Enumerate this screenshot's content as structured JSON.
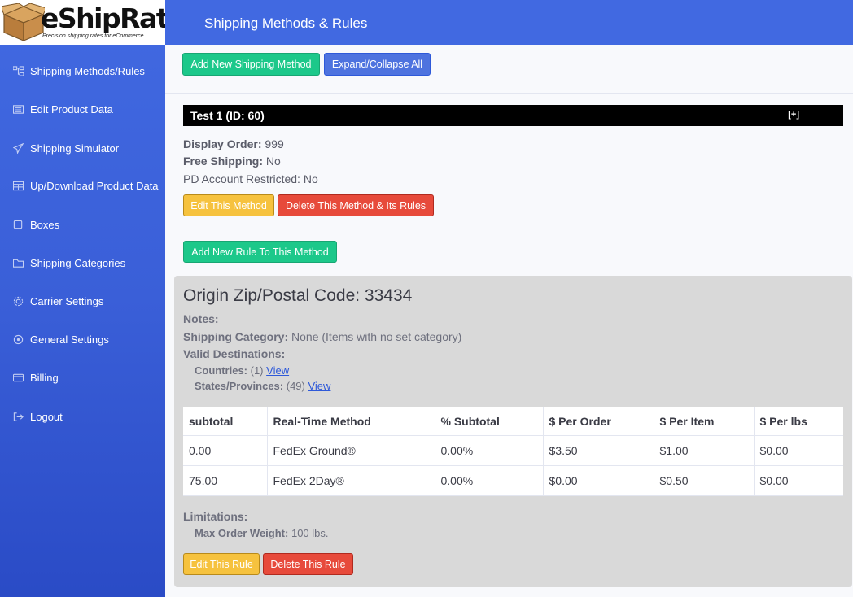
{
  "brand": {
    "name": "eShipRate",
    "tagline": "Precision shipping rates for eCommerce"
  },
  "header": {
    "title": "Shipping Methods & Rules"
  },
  "sidebar": {
    "items": [
      {
        "label": "Shipping Methods/Rules",
        "icon": "sitemap-icon"
      },
      {
        "label": "Edit Product Data",
        "icon": "list-icon"
      },
      {
        "label": "Shipping Simulator",
        "icon": "paper-plane-icon"
      },
      {
        "label": "Up/Download Product Data",
        "icon": "table-icon"
      },
      {
        "label": "Boxes",
        "icon": "square-icon"
      },
      {
        "label": "Shipping Categories",
        "icon": "folder-icon"
      },
      {
        "label": "Carrier Settings",
        "icon": "gear-icon"
      },
      {
        "label": "General Settings",
        "icon": "cog-icon"
      },
      {
        "label": "Billing",
        "icon": "credit-card-icon"
      },
      {
        "label": "Logout",
        "icon": "sign-out-icon"
      }
    ]
  },
  "toolbar": {
    "add_method": "Add New Shipping Method",
    "expand_collapse": "Expand/Collapse All"
  },
  "method": {
    "title": "Test 1 (ID: 60)",
    "toggle": "[+]",
    "display_order_label": "Display Order:",
    "display_order_value": "999",
    "free_shipping_label": "Free Shipping:",
    "free_shipping_value": "No",
    "pd_restricted": "PD Account Restricted: No",
    "edit_label": "Edit This Method",
    "delete_label": "Delete This Method & Its Rules",
    "add_rule_label": "Add New Rule To This Method"
  },
  "rule": {
    "origin": "Origin Zip/Postal Code: 33434",
    "notes_label": "Notes:",
    "category_label": "Shipping Category:",
    "category_value": "None (Items with no set category)",
    "destinations_label": "Valid Destinations:",
    "countries_label": "Countries:",
    "countries_value": "(1)",
    "states_label": "States/Provinces:",
    "states_value": "(49)",
    "view_link": "View",
    "table": {
      "headers": [
        "subtotal",
        "Real-Time Method",
        "% Subtotal",
        "$ Per Order",
        "$ Per Item",
        "$ Per lbs"
      ],
      "rows": [
        [
          "0.00",
          "FedEx Ground®",
          "0.00%",
          "$3.50",
          "$1.00",
          "$0.00"
        ],
        [
          "75.00",
          "FedEx 2Day®",
          "0.00%",
          "$0.00",
          "$0.50",
          "$0.00"
        ]
      ]
    },
    "limitations_label": "Limitations:",
    "max_weight_label": "Max Order Weight:",
    "max_weight_value": "100 lbs.",
    "edit_label": "Edit This Rule",
    "delete_label": "Delete This Rule"
  },
  "colors": {
    "sidebar": "#4169e1",
    "green": "#1cc88a",
    "blue": "#4e73df",
    "yellow": "#f6c23e",
    "red": "#e74a3b"
  }
}
